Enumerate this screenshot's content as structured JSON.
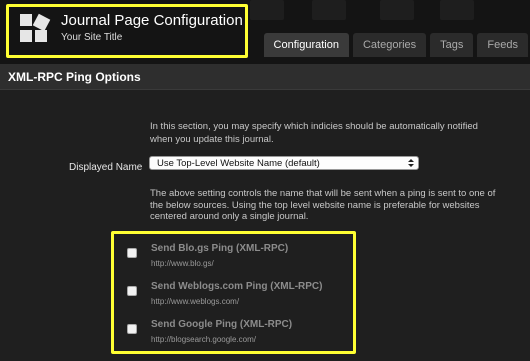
{
  "header": {
    "app_title": "Journal Page Configuration",
    "site_title": "Your Site Title"
  },
  "tabs": [
    {
      "label": "Configuration",
      "active": true
    },
    {
      "label": "Categories",
      "active": false
    },
    {
      "label": "Tags",
      "active": false
    },
    {
      "label": "Feeds",
      "active": false
    }
  ],
  "section": {
    "title": "XML-RPC Ping Options",
    "intro": "In this section, you may specify which indicies should be automatically notified when you update this journal.",
    "displayed_name": {
      "label": "Displayed Name",
      "selected": "Use Top-Level Website Name (default)"
    },
    "note": "The above setting controls the name that will be sent when a ping is sent to one of the below sources. Using the top level website name is preferable for websites centered around only a single journal."
  },
  "pings": [
    {
      "label": "Send Blo.gs Ping (XML-RPC)",
      "url": "http://www.blo.gs/",
      "checked": false
    },
    {
      "label": "Send Weblogs.com Ping (XML-RPC)",
      "url": "http://www.weblogs.com/",
      "checked": false
    },
    {
      "label": "Send Google Ping (XML-RPC)",
      "url": "http://blogsearch.google.com/",
      "checked": false
    }
  ],
  "colors": {
    "highlight": "#ffff33",
    "background": "#1f1f1f",
    "header": "#141414"
  }
}
